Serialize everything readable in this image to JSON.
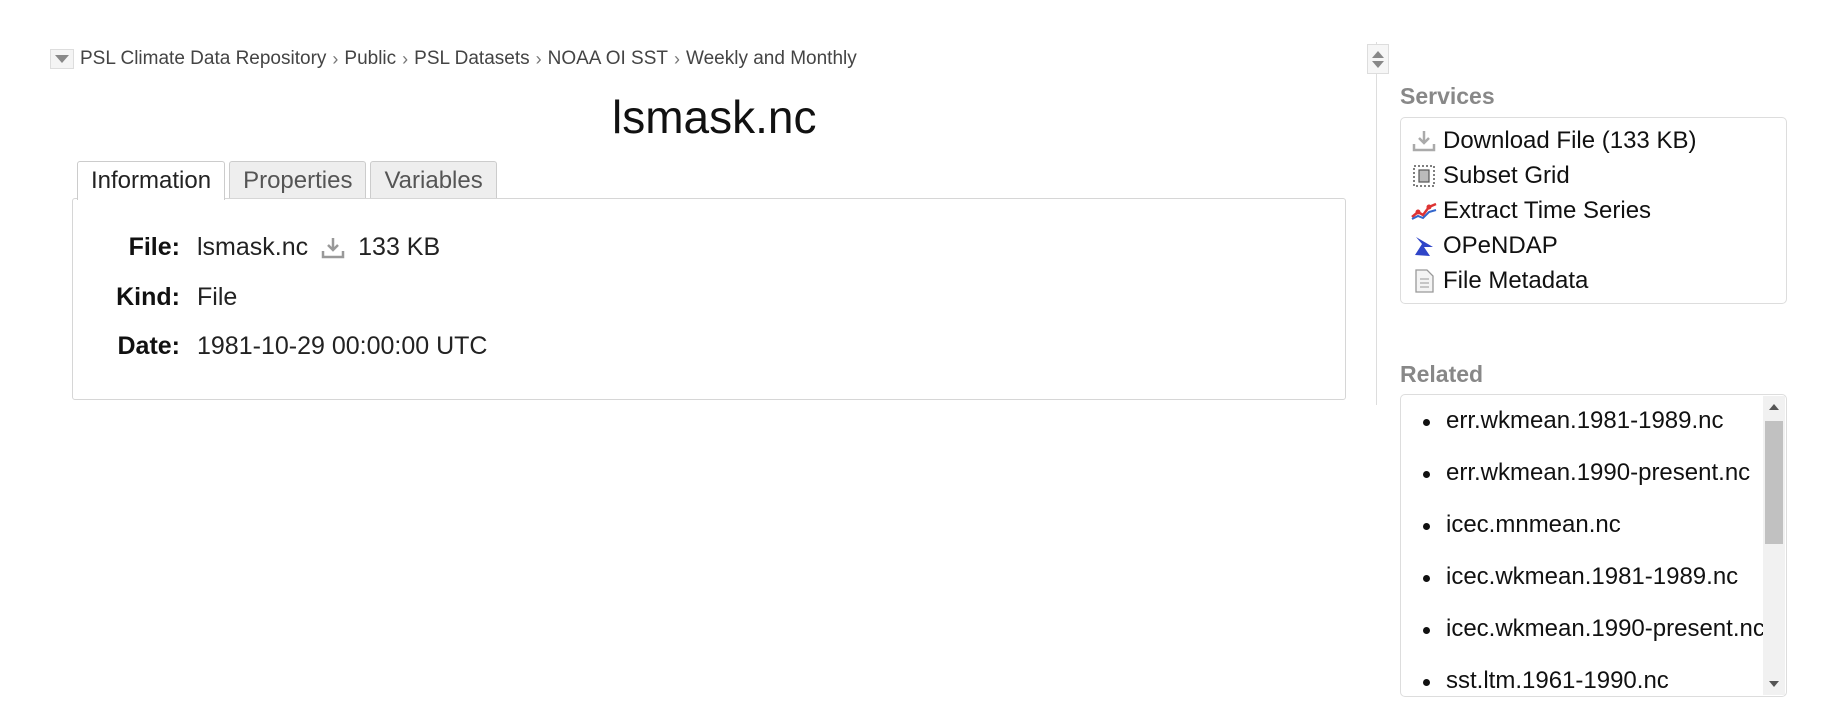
{
  "breadcrumb": {
    "items": [
      "PSL Climate Data Repository",
      "Public",
      "PSL Datasets",
      "NOAA OI SST",
      "Weekly and Monthly"
    ],
    "separator": "›"
  },
  "title": "lsmask.nc",
  "tabs": [
    {
      "label": "Information",
      "active": true
    },
    {
      "label": "Properties",
      "active": false
    },
    {
      "label": "Variables",
      "active": false
    }
  ],
  "info": {
    "file_label": "File:",
    "file_name": "lsmask.nc",
    "file_size": "133 KB",
    "kind_label": "Kind:",
    "kind_value": "File",
    "date_label": "Date:",
    "date_value": "1981-10-29 00:00:00 UTC"
  },
  "services": {
    "heading": "Services",
    "items": [
      {
        "label": "Download File (133 KB)",
        "icon": "download-icon"
      },
      {
        "label": "Subset Grid",
        "icon": "subset-grid-icon"
      },
      {
        "label": "Extract Time Series",
        "icon": "time-series-icon"
      },
      {
        "label": "OPeNDAP",
        "icon": "opendap-icon"
      },
      {
        "label": "File Metadata",
        "icon": "file-metadata-icon"
      }
    ]
  },
  "related": {
    "heading": "Related",
    "items": [
      "err.wkmean.1981-1989.nc",
      "err.wkmean.1990-present.nc",
      "icec.mnmean.nc",
      "icec.wkmean.1981-1989.nc",
      "icec.wkmean.1990-present.nc",
      "sst.ltm.1961-1990.nc"
    ]
  }
}
